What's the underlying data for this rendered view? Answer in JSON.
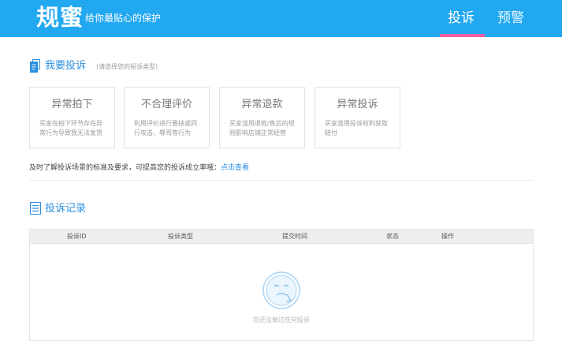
{
  "header": {
    "logo": "规蜜",
    "tagline": "给你最贴心的保护",
    "tabs": [
      {
        "label": "投诉",
        "active": true
      },
      {
        "label": "预警",
        "active": false
      }
    ],
    "background_color": "#22a8f0",
    "active_tab_color": "#f25fa2"
  },
  "complaint_section": {
    "title": "我要投诉",
    "hint": "(请选择您的投诉类型)",
    "icon": "document-icon",
    "cards": [
      {
        "title": "异常拍下",
        "desc": "买家在拍下环节存在异常行为导致我无法发货"
      },
      {
        "title": "不合理评价",
        "desc": "利用评价进行要挟或同行攻击、辱骂等行为"
      },
      {
        "title": "异常退款",
        "desc": "买家滥用退款/售后的规则影响店铺正常经营"
      },
      {
        "title": "异常投诉",
        "desc": "买家滥用投诉权利获取赔付"
      }
    ],
    "tip": "及时了解投诉场景的标准及要求，可提高您的投诉成立率哦：",
    "tip_link": "点击查看"
  },
  "records_section": {
    "title": "投诉记录",
    "icon": "list-icon",
    "columns": [
      "投诉ID",
      "投诉类型",
      "提交时间",
      "状态",
      "操作"
    ],
    "rows": [],
    "empty_text": "您还没做过任何投诉",
    "empty_icon": "empty-face-icon"
  },
  "colors": {
    "accent": "#2b8fe0",
    "border": "#e3e3e3"
  }
}
